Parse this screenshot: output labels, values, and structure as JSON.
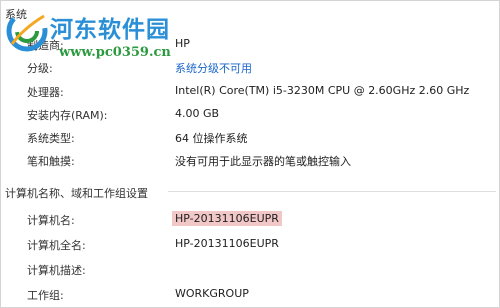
{
  "watermark": {
    "brand": "河东软件园",
    "url": "www.pc0359.cn",
    "brand_color": "#2a8fd6",
    "url_color": "#2b9a3f"
  },
  "system": {
    "section_title": "系统",
    "rows": [
      {
        "label": "制造商:",
        "value": "HP"
      },
      {
        "label": "分级:",
        "value": "系统分级不可用",
        "link": true
      },
      {
        "label": "处理器:",
        "value": "Intel(R) Core(TM) i5-3230M CPU @ 2.60GHz   2.60 GHz"
      },
      {
        "label": "安装内存(RAM):",
        "value": "4.00 GB"
      },
      {
        "label": "系统类型:",
        "value": "64 位操作系统"
      },
      {
        "label": "笔和触摸:",
        "value": "没有可用于此显示器的笔或触控输入"
      }
    ]
  },
  "computer": {
    "section_title": "计算机名称、域和工作组设置",
    "rows": [
      {
        "label": "计算机名:",
        "value": "HP-20131106EUPR",
        "highlight": true
      },
      {
        "label": "计算机全名:",
        "value": "HP-20131106EUPR"
      },
      {
        "label": "计算机描述:",
        "value": ""
      },
      {
        "label": "工作组:",
        "value": "WORKGROUP"
      }
    ]
  },
  "colors": {
    "link": "#1a66c9",
    "highlight": "#f1c7c7"
  }
}
